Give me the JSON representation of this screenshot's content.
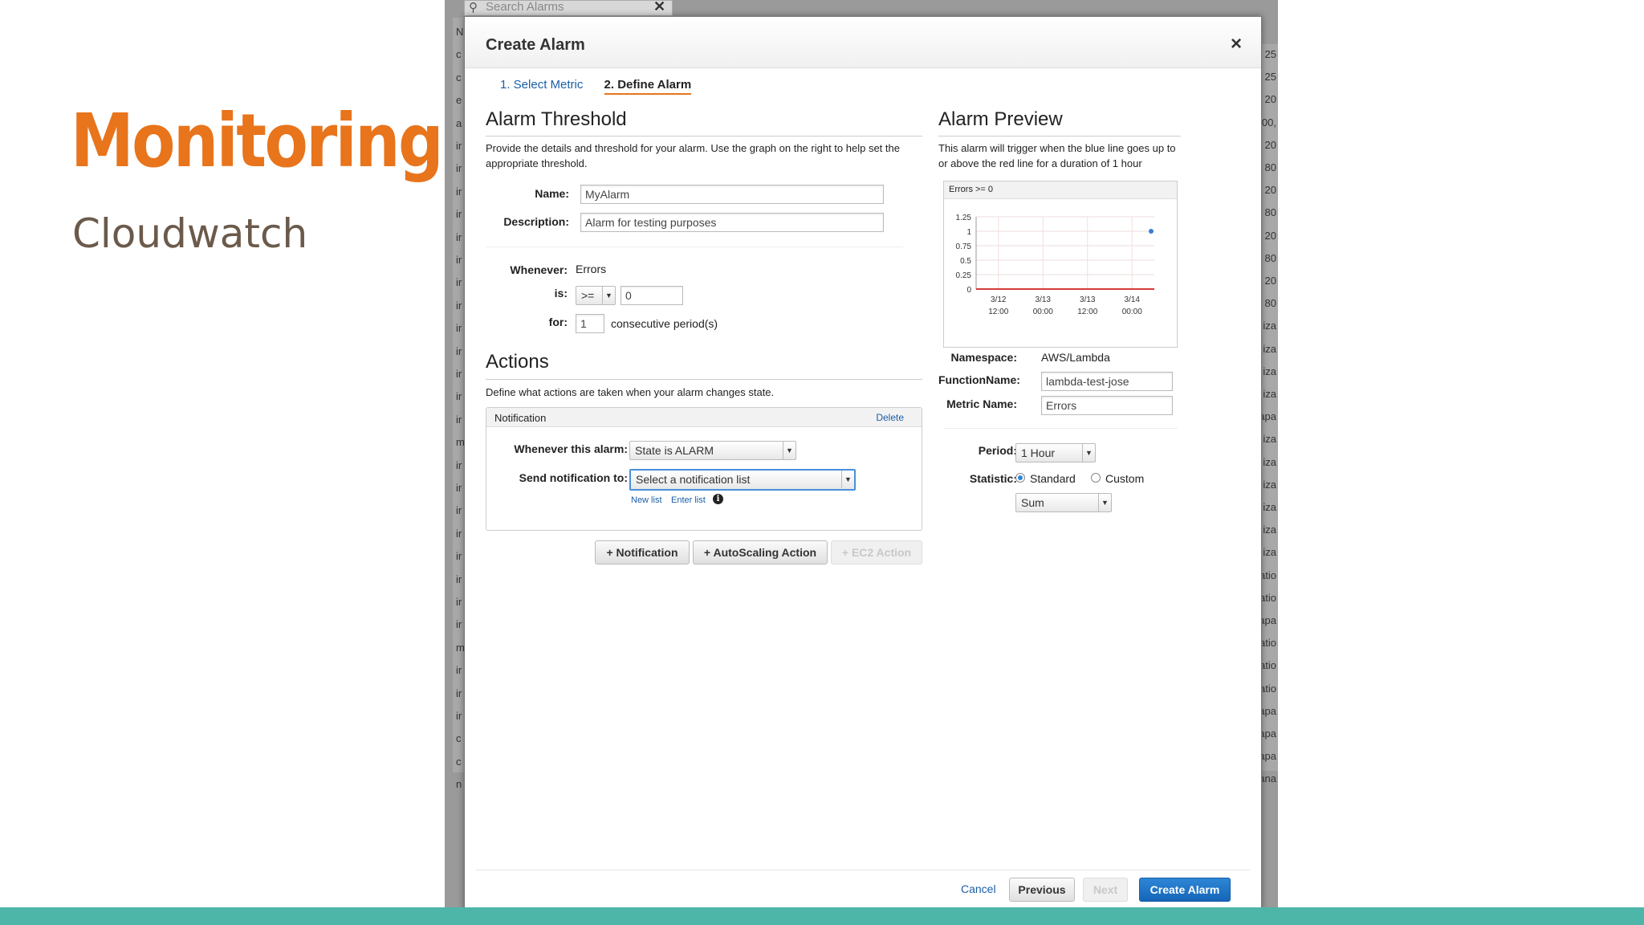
{
  "slide": {
    "title": "Monitoring",
    "subtitle": "Cloudwatch"
  },
  "background": {
    "search_placeholder": "Search Alarms",
    "left_column": [
      "N",
      "c",
      "c",
      "e",
      "a",
      "ir",
      "ir",
      "ir",
      "ir",
      "ir",
      "ir",
      "ir",
      "ir",
      "ir",
      "ir",
      "ir",
      "ir",
      "ir",
      "m",
      "ir",
      "ir",
      "ir",
      "ir",
      "ir",
      "ir",
      "ir",
      "ir",
      "m",
      "ir",
      "ir",
      "ir",
      "c",
      "c",
      "n"
    ],
    "right_column": [
      "25",
      "25",
      "20",
      "00,",
      "20",
      "80",
      "20",
      "80",
      "20",
      "80",
      "20",
      "80",
      "iza",
      "iza",
      "iza",
      "iza",
      "apa",
      "iza",
      "iza",
      "iza",
      "iza",
      "iza",
      "iza",
      "atio",
      "atio",
      "apa",
      "atio",
      "atio",
      "atio",
      "apa",
      "apa",
      "apa",
      "ana"
    ]
  },
  "dialog": {
    "title": "Create Alarm",
    "close": "×",
    "steps": [
      "1. Select Metric",
      "2. Define Alarm"
    ],
    "threshold": {
      "title": "Alarm Threshold",
      "help": "Provide the details and threshold for your alarm. Use the graph on the right to help set the appropriate threshold.",
      "name_label": "Name:",
      "name_value": "MyAlarm",
      "description_label": "Description:",
      "description_value": "Alarm for testing purposes",
      "whenever_label": "Whenever:",
      "whenever_value": "Errors",
      "is_label": "is:",
      "operator": ">=",
      "threshold_value": "0",
      "for_label": "for:",
      "for_value": "1",
      "periods_text": "consecutive period(s)"
    },
    "actions": {
      "title": "Actions",
      "help": "Define what actions are taken when your alarm changes state.",
      "notification_header": "Notification",
      "delete": "Delete",
      "whenever_label": "Whenever this alarm:",
      "state_value": "State is ALARM",
      "send_label": "Send notification to:",
      "send_placeholder": "Select a notification list",
      "new_list": "New list",
      "enter_list": "Enter list",
      "info_icon": "i",
      "add_notification": "+ Notification",
      "add_autoscaling": "+ AutoScaling Action",
      "add_ec2": "+ EC2 Action"
    },
    "preview": {
      "title": "Alarm Preview",
      "help": "This alarm will trigger when the blue line goes up to or above the red line for a duration of 1 hour",
      "chart_header": "Errors >= 0",
      "namespace_label": "Namespace:",
      "namespace_value": "AWS/Lambda",
      "function_label": "FunctionName:",
      "function_value": "lambda-test-jose",
      "metric_label": "Metric Name:",
      "metric_value": "Errors",
      "period_label": "Period:",
      "period_value": "1 Hour",
      "statistic_label": "Statistic:",
      "standard": "Standard",
      "custom": "Custom",
      "statistic_value": "Sum"
    },
    "footer": {
      "cancel": "Cancel",
      "previous": "Previous",
      "next": "Next",
      "create": "Create Alarm"
    }
  },
  "chart_data": {
    "type": "line",
    "title": "Errors >= 0",
    "x_ticks": [
      [
        "3/12",
        "12:00"
      ],
      [
        "3/13",
        "00:00"
      ],
      [
        "3/13",
        "12:00"
      ],
      [
        "3/14",
        "00:00"
      ]
    ],
    "y_ticks": [
      "1.25",
      "1",
      "0.75",
      "0.5",
      "0.25",
      "0"
    ],
    "ylim": [
      0,
      1.25
    ],
    "series": [
      {
        "color": "#3a7bd5",
        "points": [
          {
            "x": 4,
            "y": 1
          }
        ]
      },
      {
        "color": "#d43a3a",
        "points": [
          {
            "x": 0,
            "y": 0
          },
          {
            "x": 4,
            "y": 0
          }
        ]
      }
    ],
    "grid": true
  }
}
